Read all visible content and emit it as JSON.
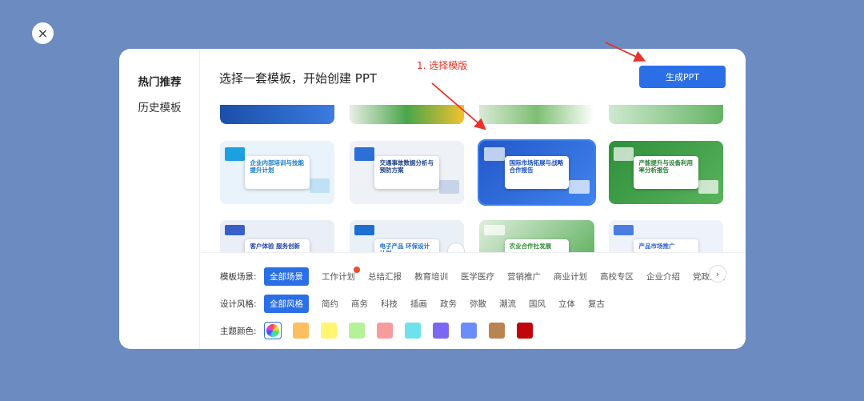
{
  "close_label": "×",
  "sidebar": {
    "items": [
      {
        "label": "热门推荐"
      },
      {
        "label": "历史模板"
      }
    ]
  },
  "header": {
    "title": "选择一套模板，开始创建 PPT",
    "generate_label": "生成PPT"
  },
  "annotation": {
    "text": "1. 选择模版",
    "color": "#e8322b"
  },
  "templates": [
    {
      "title": "企业内部培训与技能提升计划"
    },
    {
      "title": "交通事故数据分析与预防方案"
    },
    {
      "title": "国际市场拓展与战略合作报告"
    },
    {
      "title": "产能提升与设备利用率分析报告"
    },
    {
      "title": "客户体验 服务创新"
    },
    {
      "title": "电子产品 环保设计计划"
    },
    {
      "title": "农业合作社发展"
    },
    {
      "title": "产品市场推广"
    }
  ],
  "filters": {
    "scene": {
      "label": "模板场景:",
      "options": [
        "全部场景",
        "工作计划",
        "总结汇报",
        "教育培训",
        "医学医疗",
        "营销推广",
        "商业计划",
        "高校专区",
        "企业介绍",
        "党政宣传"
      ]
    },
    "style": {
      "label": "设计风格:",
      "options": [
        "全部风格",
        "简约",
        "商务",
        "科技",
        "插画",
        "政务",
        "弥散",
        "潮流",
        "国风",
        "立体",
        "复古"
      ]
    },
    "color": {
      "label": "主题颜色:",
      "swatches": [
        "#fbbf60",
        "#fff570",
        "#b4f29a",
        "#f79c9c",
        "#6ee2ea",
        "#7b67f4",
        "#6c8cfb",
        "#b98452",
        "#c0060a"
      ]
    }
  },
  "colors": {
    "accent": "#2b6fe6",
    "background": "#6b8bc1"
  }
}
